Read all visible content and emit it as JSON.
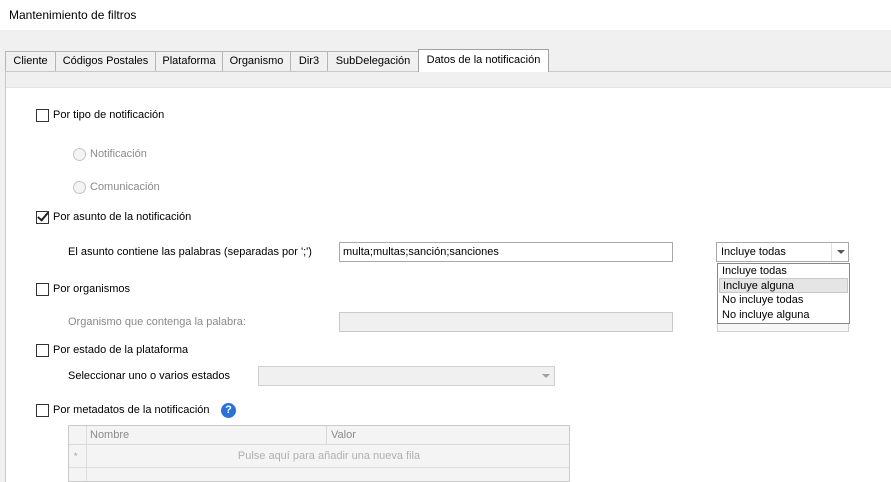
{
  "window": {
    "title": "Mantenimiento de filtros"
  },
  "tabs": [
    {
      "label": "Cliente"
    },
    {
      "label": "Códigos Postales"
    },
    {
      "label": "Plataforma"
    },
    {
      "label": "Organismo"
    },
    {
      "label": "Dir3"
    },
    {
      "label": "SubDelegación"
    },
    {
      "label": "Datos de la notificación",
      "active": true
    }
  ],
  "por_tipo": {
    "label": "Por tipo de notificación",
    "checked": false,
    "options": [
      {
        "label": "Notificación",
        "selected": false,
        "enabled": false
      },
      {
        "label": "Comunicación",
        "selected": false,
        "enabled": false
      }
    ]
  },
  "por_asunto": {
    "label": "Por asunto de la notificación",
    "checked": true,
    "field_label": "El asunto contiene las palabras (separadas por ';')",
    "value": "multa;multas;sanción;sanciones",
    "mode_selected": "Incluye todas",
    "mode_options": [
      "Incluye todas",
      "Incluye alguna",
      "No incluye todas",
      "No incluye alguna"
    ],
    "highlighted_option": "Incluye alguna"
  },
  "por_organismos": {
    "label": "Por organismos",
    "checked": false,
    "field_label": "Organismo que contenga la palabra:",
    "value": ""
  },
  "por_estado": {
    "label": "Por estado de la plataforma",
    "checked": false,
    "field_label": "Seleccionar uno o varios estados",
    "value": ""
  },
  "por_metadatos": {
    "label": "Por metadatos de la notificación",
    "checked": false,
    "help_glyph": "?",
    "grid": {
      "columns": [
        "Nombre",
        "Valor"
      ],
      "new_row_marker": "*",
      "new_row_hint": "Pulse aquí para añadir una nueva fila"
    }
  },
  "colors": {
    "accent_help": "#2b72d8",
    "disabled_text": "#8a8a8a",
    "hover_row": "#e5e5e5"
  }
}
